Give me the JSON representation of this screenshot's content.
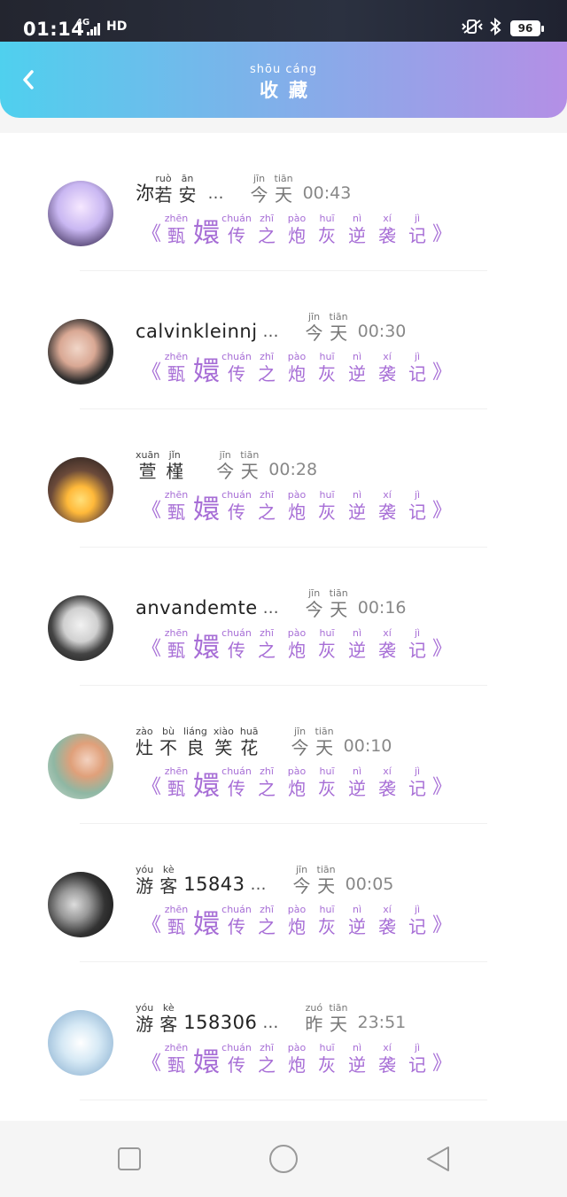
{
  "status": {
    "time": "01:14",
    "network": "4G",
    "hd": "HD",
    "battery": "96"
  },
  "header": {
    "title_pinyin": "shōu cáng",
    "title": "收藏"
  },
  "book": {
    "open_quote": "《",
    "close_quote": "》",
    "words": [
      {
        "py": "zhēn",
        "hz": "甄"
      },
      {
        "py": "",
        "hz": "嬛"
      },
      {
        "py": "chuán",
        "hz": "传"
      },
      {
        "py": "zhī",
        "hz": "之"
      },
      {
        "py": "pào",
        "hz": "炮"
      },
      {
        "py": "huī",
        "hz": "灰"
      },
      {
        "py": "nì",
        "hz": "逆"
      },
      {
        "py": "xí",
        "hz": "袭"
      },
      {
        "py": "jì",
        "hz": "记"
      }
    ]
  },
  "items": [
    {
      "first": "沵",
      "name_words": [
        {
          "py": "ruò",
          "hz": "若"
        },
        {
          "py": "ān",
          "hz": "安"
        }
      ],
      "name_text": "",
      "ellipsis": "…",
      "day_words": [
        {
          "py": "jīn",
          "hz": "今"
        },
        {
          "py": "tiān",
          "hz": "天"
        }
      ],
      "time": "00:43"
    },
    {
      "first": "",
      "name_words": [],
      "name_text": "calvinkleinnj",
      "ellipsis": "…",
      "day_words": [
        {
          "py": "jīn",
          "hz": "今"
        },
        {
          "py": "tiān",
          "hz": "天"
        }
      ],
      "time": "00:30"
    },
    {
      "first": "",
      "name_words": [
        {
          "py": "xuān",
          "hz": "萱"
        },
        {
          "py": "jǐn",
          "hz": "槿"
        }
      ],
      "name_text": "",
      "ellipsis": "",
      "day_words": [
        {
          "py": "jīn",
          "hz": "今"
        },
        {
          "py": "tiān",
          "hz": "天"
        }
      ],
      "time": "00:28"
    },
    {
      "first": "",
      "name_words": [],
      "name_text": "anvandemte",
      "ellipsis": "…",
      "day_words": [
        {
          "py": "jīn",
          "hz": "今"
        },
        {
          "py": "tiān",
          "hz": "天"
        }
      ],
      "time": "00:16"
    },
    {
      "first": "",
      "name_words": [
        {
          "py": "zào",
          "hz": "灶"
        },
        {
          "py": "bù",
          "hz": "不"
        },
        {
          "py": "liáng",
          "hz": "良"
        },
        {
          "py": "xiào",
          "hz": "笑"
        },
        {
          "py": "huā",
          "hz": "花"
        }
      ],
      "name_text": "",
      "ellipsis": "",
      "day_words": [
        {
          "py": "jīn",
          "hz": "今"
        },
        {
          "py": "tiān",
          "hz": "天"
        }
      ],
      "time": "00:10"
    },
    {
      "first": "",
      "name_words": [
        {
          "py": "yóu",
          "hz": "游"
        },
        {
          "py": "kè",
          "hz": "客"
        }
      ],
      "name_text": "15843",
      "ellipsis": "…",
      "day_words": [
        {
          "py": "jīn",
          "hz": "今"
        },
        {
          "py": "tiān",
          "hz": "天"
        }
      ],
      "time": "00:05"
    },
    {
      "first": "",
      "name_words": [
        {
          "py": "yóu",
          "hz": "游"
        },
        {
          "py": "kè",
          "hz": "客"
        }
      ],
      "name_text": "158306",
      "ellipsis": "…",
      "day_words": [
        {
          "py": "zuó",
          "hz": "昨"
        },
        {
          "py": "tiān",
          "hz": "天"
        }
      ],
      "time": "23:51"
    }
  ],
  "icons": {
    "back": "chevron-left-icon",
    "nav_recent": "square-icon",
    "nav_home": "circle-icon",
    "nav_back": "triangle-back-icon"
  },
  "colors": {
    "accent_purple": "#a76ed6",
    "header_start": "#4fd0ee",
    "header_end": "#b48fe6"
  }
}
